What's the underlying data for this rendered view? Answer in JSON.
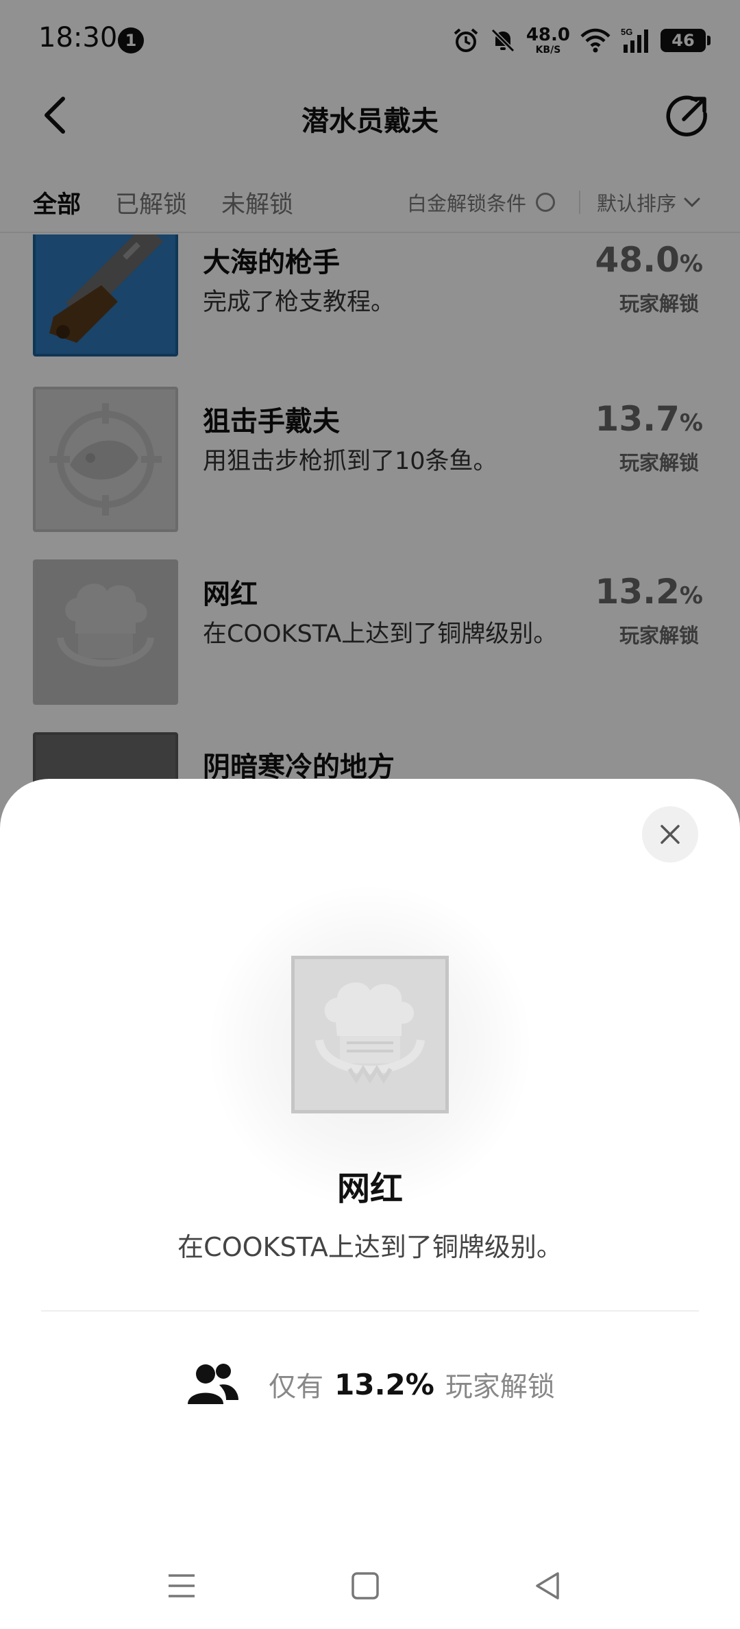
{
  "status_bar": {
    "time": "18:30",
    "notification_count": "1",
    "net_speed_value": "48.0",
    "net_speed_unit": "KB/S",
    "signal_label": "5G",
    "battery": "46"
  },
  "nav": {
    "title": "潜水员戴夫"
  },
  "filter": {
    "tabs": [
      {
        "label": "全部",
        "active": true
      },
      {
        "label": "已解锁",
        "active": false
      },
      {
        "label": "未解锁",
        "active": false
      }
    ],
    "platinum_label": "白金解锁条件",
    "sort_label": "默认排序"
  },
  "achievements": [
    {
      "name": "大海的枪手",
      "desc": "完成了枪支教程。",
      "pct": "48.0",
      "pct_unit": "%",
      "unlock_label": "玩家解锁"
    },
    {
      "name": "狙击手戴夫",
      "desc": "用狙击步枪抓到了10条鱼。",
      "pct": "13.7",
      "pct_unit": "%",
      "unlock_label": "玩家解锁"
    },
    {
      "name": "网红",
      "desc": "在COOKSTA上达到了铜牌级别。",
      "pct": "13.2",
      "pct_unit": "%",
      "unlock_label": "玩家解锁"
    },
    {
      "name": "阴暗寒冷的地方",
      "desc": "",
      "pct": "",
      "pct_unit": "",
      "unlock_label": ""
    }
  ],
  "sheet": {
    "title": "网红",
    "desc": "在COOKSTA上达到了铜牌级别。",
    "stats_prefix": "仅有",
    "stats_value": "13.2%",
    "stats_suffix": "玩家解锁"
  },
  "icons": {
    "back": "chevron-left-icon",
    "share": "share-icon",
    "close": "close-icon",
    "people": "people-icon",
    "alarm": "alarm-icon",
    "mute": "bell-off-icon",
    "wifi": "wifi-icon",
    "signal": "signal-icon"
  },
  "colors": {
    "overlay": "#6f6f6f",
    "active_tab": "#111111",
    "muted_text": "#777777"
  }
}
